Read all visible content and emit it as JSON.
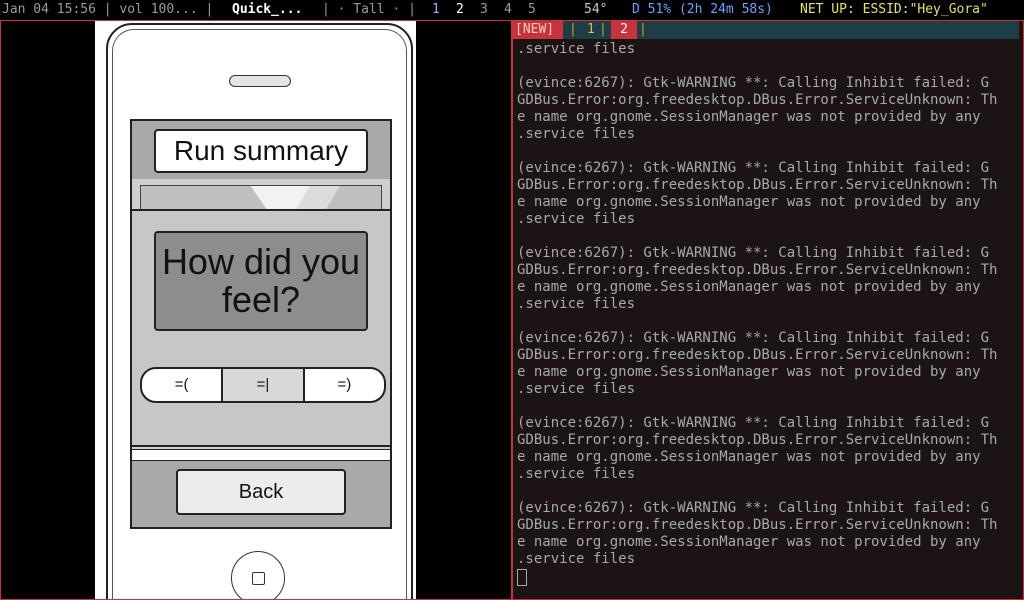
{
  "statusbar": {
    "date": "Jan 04 15:56 | vol 100... |",
    "window_title": "Quick_...",
    "layout": "| · Tall · |",
    "workspaces": [
      "1",
      "2",
      "3",
      "4",
      "5"
    ],
    "temperature": "54°",
    "battery": "D 51% (2h 24m 58s)",
    "network": "NET UP: ESSID:\"Hey_Gora\""
  },
  "mockup": {
    "summary_title": "Run summary",
    "question": "How did you feel?",
    "moods": [
      "=(",
      "=|",
      "=)"
    ],
    "back_label": "Back"
  },
  "terminal": {
    "tabs": {
      "new": "[NEW]",
      "tab1": "1",
      "tab2": "2",
      "sep": "|"
    },
    "lines": [
      ".service files",
      "",
      "(evince:6267): Gtk-WARNING **: Calling Inhibit failed: G",
      "GDBus.Error:org.freedesktop.DBus.Error.ServiceUnknown: Th",
      "e name org.gnome.SessionManager was not provided by any",
      ".service files",
      "",
      "(evince:6267): Gtk-WARNING **: Calling Inhibit failed: G",
      "GDBus.Error:org.freedesktop.DBus.Error.ServiceUnknown: Th",
      "e name org.gnome.SessionManager was not provided by any",
      ".service files",
      "",
      "(evince:6267): Gtk-WARNING **: Calling Inhibit failed: G",
      "GDBus.Error:org.freedesktop.DBus.Error.ServiceUnknown: Th",
      "e name org.gnome.SessionManager was not provided by any",
      ".service files",
      "",
      "(evince:6267): Gtk-WARNING **: Calling Inhibit failed: G",
      "GDBus.Error:org.freedesktop.DBus.Error.ServiceUnknown: Th",
      "e name org.gnome.SessionManager was not provided by any",
      ".service files",
      "",
      "(evince:6267): Gtk-WARNING **: Calling Inhibit failed: G",
      "GDBus.Error:org.freedesktop.DBus.Error.ServiceUnknown: Th",
      "e name org.gnome.SessionManager was not provided by any",
      ".service files",
      "",
      "(evince:6267): Gtk-WARNING **: Calling Inhibit failed: G",
      "GDBus.Error:org.freedesktop.DBus.Error.ServiceUnknown: Th",
      "e name org.gnome.SessionManager was not provided by any",
      ".service files"
    ]
  }
}
